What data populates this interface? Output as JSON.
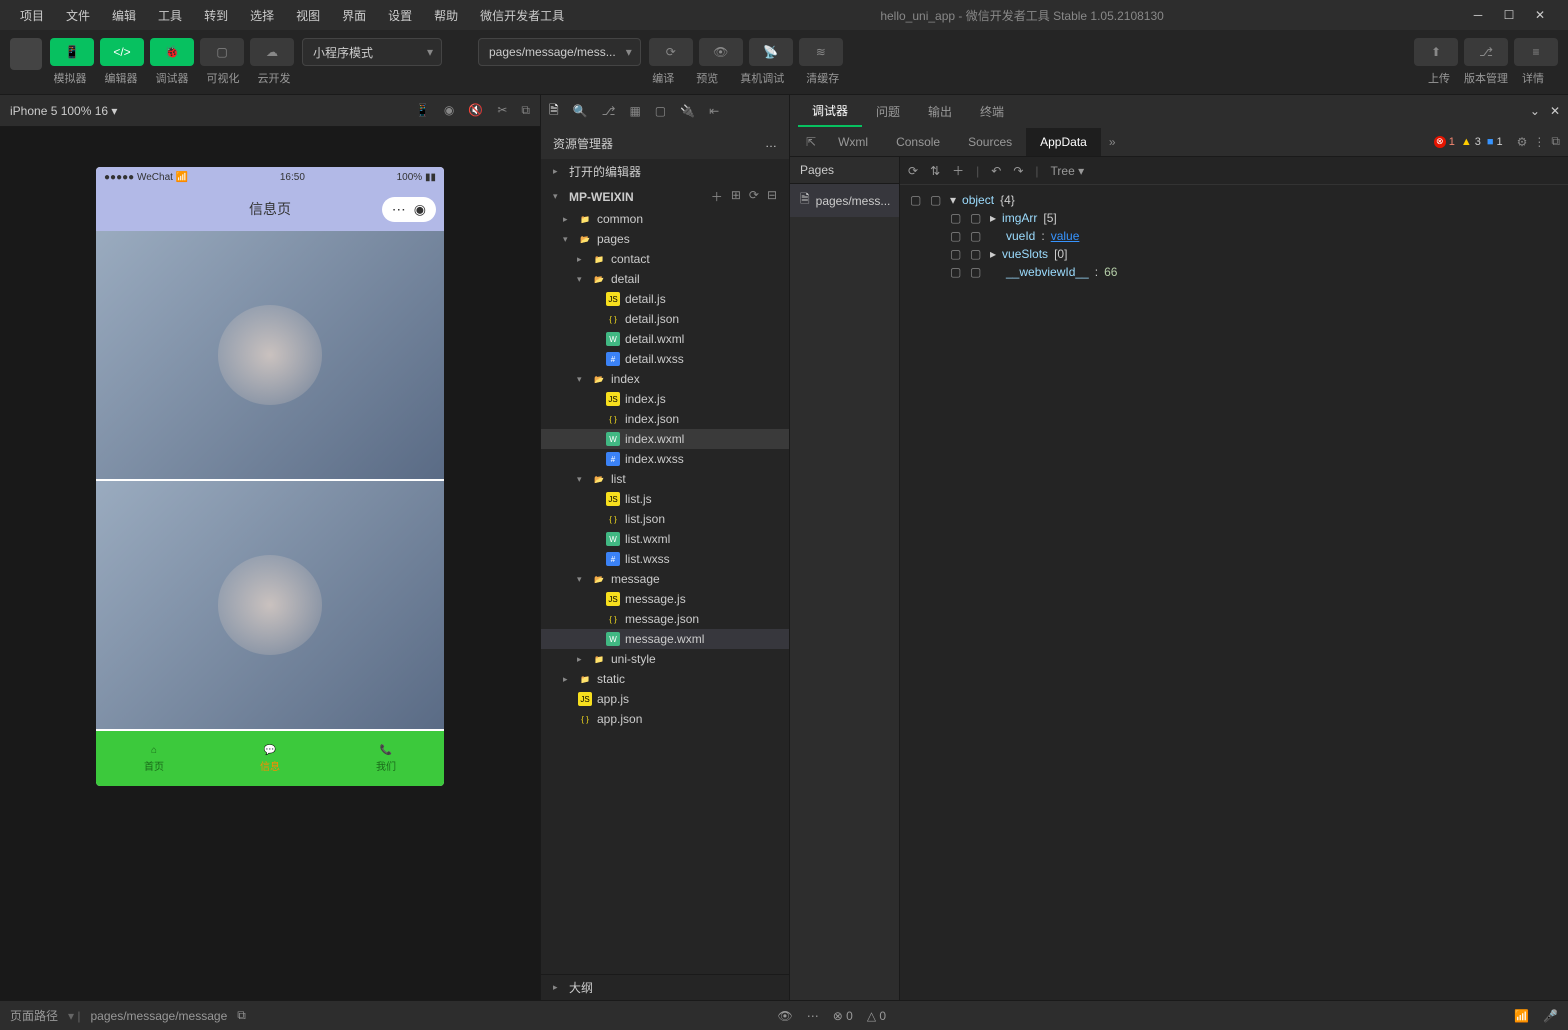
{
  "menubar": {
    "items": [
      "项目",
      "文件",
      "编辑",
      "工具",
      "转到",
      "选择",
      "视图",
      "界面",
      "设置",
      "帮助",
      "微信开发者工具"
    ],
    "title": "hello_uni_app - 微信开发者工具 Stable 1.05.2108130"
  },
  "toolbar": {
    "labels": {
      "simulator": "模拟器",
      "editor": "编辑器",
      "debugger": "调试器",
      "visual": "可视化",
      "cloud": "云开发",
      "compile": "编译",
      "preview": "预览",
      "remote": "真机调试",
      "cache": "清缓存",
      "upload": "上传",
      "version": "版本管理",
      "detail": "详情"
    },
    "mode": "小程序模式",
    "page_path": "pages/message/mess..."
  },
  "simulator": {
    "device": "iPhone 5 100% 16",
    "status": {
      "carrier": "●●●●● WeChat",
      "time": "16:50",
      "battery": "100%"
    },
    "nav_title": "信息页",
    "tabs": [
      {
        "label": "首页",
        "active": false
      },
      {
        "label": "信息",
        "active": true
      },
      {
        "label": "我们",
        "active": false
      }
    ]
  },
  "explorer": {
    "title": "资源管理器",
    "open_editors": "打开的编辑器",
    "project": "MP-WEIXIN",
    "outline": "大纲",
    "tree": [
      {
        "name": "common",
        "type": "folder",
        "depth": 1,
        "open": false
      },
      {
        "name": "pages",
        "type": "folder-red",
        "depth": 1,
        "open": true
      },
      {
        "name": "contact",
        "type": "folder",
        "depth": 2,
        "open": false
      },
      {
        "name": "detail",
        "type": "folder",
        "depth": 2,
        "open": true
      },
      {
        "name": "detail.js",
        "type": "js",
        "depth": 3
      },
      {
        "name": "detail.json",
        "type": "json",
        "depth": 3
      },
      {
        "name": "detail.wxml",
        "type": "wxml",
        "depth": 3
      },
      {
        "name": "detail.wxss",
        "type": "wxss",
        "depth": 3
      },
      {
        "name": "index",
        "type": "folder",
        "depth": 2,
        "open": true
      },
      {
        "name": "index.js",
        "type": "js",
        "depth": 3
      },
      {
        "name": "index.json",
        "type": "json",
        "depth": 3
      },
      {
        "name": "index.wxml",
        "type": "wxml",
        "depth": 3,
        "highlighted": true
      },
      {
        "name": "index.wxss",
        "type": "wxss",
        "depth": 3
      },
      {
        "name": "list",
        "type": "folder",
        "depth": 2,
        "open": true
      },
      {
        "name": "list.js",
        "type": "js",
        "depth": 3
      },
      {
        "name": "list.json",
        "type": "json",
        "depth": 3
      },
      {
        "name": "list.wxml",
        "type": "wxml",
        "depth": 3
      },
      {
        "name": "list.wxss",
        "type": "wxss",
        "depth": 3
      },
      {
        "name": "message",
        "type": "folder",
        "depth": 2,
        "open": true
      },
      {
        "name": "message.js",
        "type": "js",
        "depth": 3
      },
      {
        "name": "message.json",
        "type": "json",
        "depth": 3
      },
      {
        "name": "message.wxml",
        "type": "wxml",
        "depth": 3,
        "selected": true
      },
      {
        "name": "uni-style",
        "type": "folder",
        "depth": 2,
        "open": false
      },
      {
        "name": "static",
        "type": "folder",
        "depth": 1,
        "open": false
      },
      {
        "name": "app.js",
        "type": "js",
        "depth": 1
      },
      {
        "name": "app.json",
        "type": "json",
        "depth": 1
      }
    ]
  },
  "devtools": {
    "top_tabs": [
      "调试器",
      "问题",
      "输出",
      "终端"
    ],
    "sub_tabs": [
      "Wxml",
      "Console",
      "Sources",
      "AppData"
    ],
    "active_subtab": "AppData",
    "badges": {
      "errors": 1,
      "warnings": 3,
      "info": 1
    },
    "pages_label": "Pages",
    "page_item": "pages/mess...",
    "tree_label": "Tree",
    "data": {
      "root": "object",
      "root_count": "{4}",
      "rows": [
        {
          "key": "imgArr",
          "bracket": "[5]",
          "expand": true,
          "depth": 1
        },
        {
          "key": "vueId",
          "sep": ":",
          "val": "value",
          "link": true,
          "depth": 1
        },
        {
          "key": "vueSlots",
          "bracket": "[0]",
          "expand": true,
          "depth": 1
        },
        {
          "key": "__webviewId__",
          "sep": ":",
          "val": "66",
          "num": true,
          "depth": 1
        }
      ]
    }
  },
  "statusbar": {
    "path_label": "页面路径",
    "path": "pages/message/message",
    "errors": 0,
    "warnings": 0
  }
}
